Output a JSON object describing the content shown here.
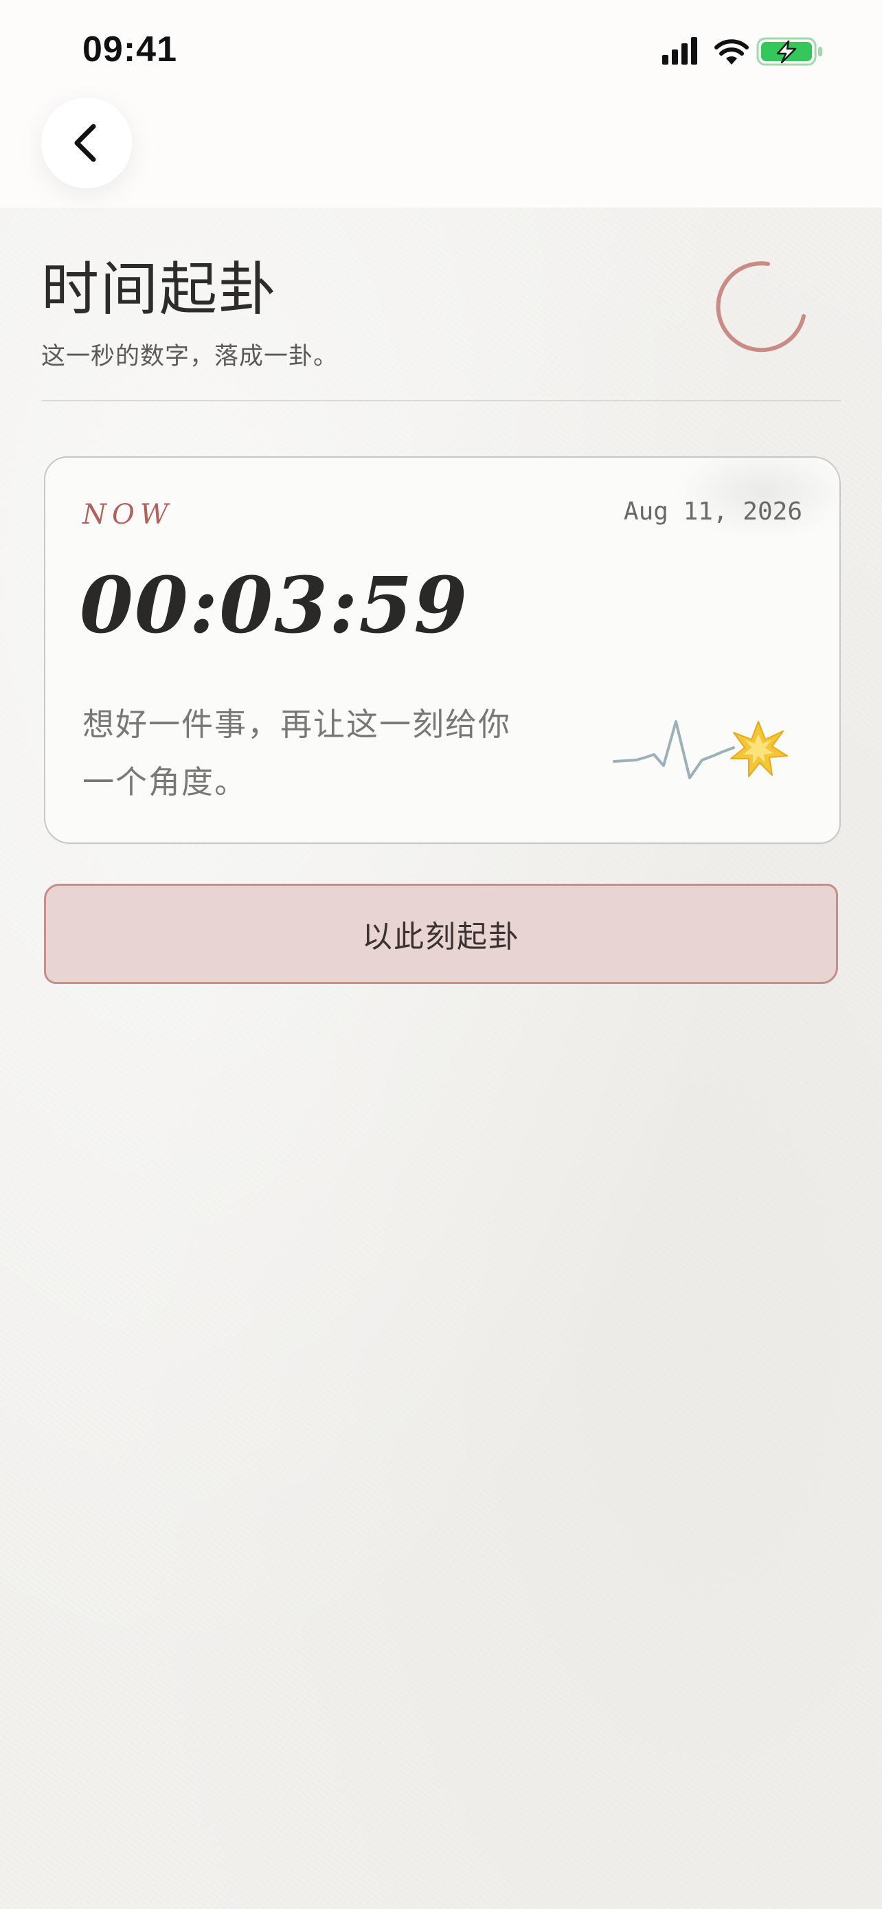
{
  "status_bar": {
    "time": "09:41"
  },
  "header": {
    "title": "时间起卦",
    "subtitle": "这一秒的数字，落成一卦。"
  },
  "card": {
    "now_label": "NOW",
    "date": "Aug 11, 2026",
    "clock": "00:03:59",
    "hint_line1": "想好一件事，再让这一刻给你",
    "hint_line2": "一个角度。"
  },
  "actions": {
    "cast_label": "以此刻起卦"
  },
  "colors": {
    "accent": "#b3605b",
    "button_fill": "#e8d4d1",
    "button_border": "#c48e89",
    "battery": "#34c759",
    "spark": "#f2c230",
    "pulse_line": "#9bb0b8"
  },
  "icons": {
    "back": "chevron-left-icon",
    "signal": "cellular-signal-icon",
    "wifi": "wifi-icon",
    "battery": "battery-charging-icon",
    "spinner": "loading-spinner-icon",
    "pulse": "pulse-line-icon",
    "spark": "spark-burst-icon"
  }
}
